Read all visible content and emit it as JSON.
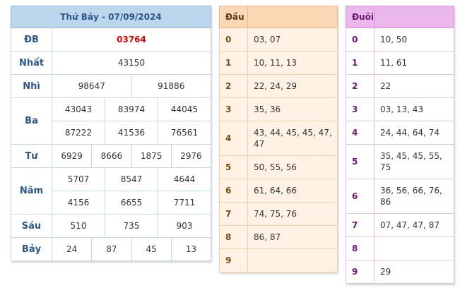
{
  "results": {
    "title": "Thứ Bảy - 07/09/2024",
    "db_label": "ĐB",
    "db": "03764",
    "nhat_label": "Nhất",
    "nhat": "43150",
    "nhi_label": "Nhì",
    "nhi": [
      "98647",
      "91886"
    ],
    "ba_label": "Ba",
    "ba": [
      "43043",
      "83974",
      "44045",
      "87222",
      "41536",
      "76561"
    ],
    "tu_label": "Tư",
    "tu": [
      "6929",
      "8666",
      "1875",
      "2976"
    ],
    "nam_label": "Năm",
    "nam": [
      "5707",
      "8547",
      "4644",
      "4156",
      "6655",
      "7711"
    ],
    "sau_label": "Sáu",
    "sau": [
      "510",
      "735",
      "903"
    ],
    "bay_label": "Bảy",
    "bay": [
      "24",
      "87",
      "45",
      "13"
    ]
  },
  "dau": {
    "header_key": "Đầu",
    "header_val": "",
    "rows": [
      {
        "k": "0",
        "v": "03, 07"
      },
      {
        "k": "1",
        "v": "10, 11, 13"
      },
      {
        "k": "2",
        "v": "22, 24, 29"
      },
      {
        "k": "3",
        "v": "35, 36"
      },
      {
        "k": "4",
        "v": "43, 44, 45, 45, 47, 47"
      },
      {
        "k": "5",
        "v": "50, 55, 56"
      },
      {
        "k": "6",
        "v": "61, 64, 66"
      },
      {
        "k": "7",
        "v": "74, 75, 76"
      },
      {
        "k": "8",
        "v": "86, 87"
      },
      {
        "k": "9",
        "v": ""
      }
    ]
  },
  "duoi": {
    "header_key": "Đuôi",
    "header_val": "",
    "rows": [
      {
        "k": "0",
        "v": "10, 50"
      },
      {
        "k": "1",
        "v": "11, 61"
      },
      {
        "k": "2",
        "v": "22"
      },
      {
        "k": "3",
        "v": "03, 13, 43"
      },
      {
        "k": "4",
        "v": "24, 44, 64, 74"
      },
      {
        "k": "5",
        "v": "35, 45, 45, 55, 75"
      },
      {
        "k": "6",
        "v": "36, 56, 66, 76, 86"
      },
      {
        "k": "7",
        "v": "07, 47, 47, 87"
      },
      {
        "k": "8",
        "v": ""
      },
      {
        "k": "9",
        "v": "29"
      }
    ]
  }
}
